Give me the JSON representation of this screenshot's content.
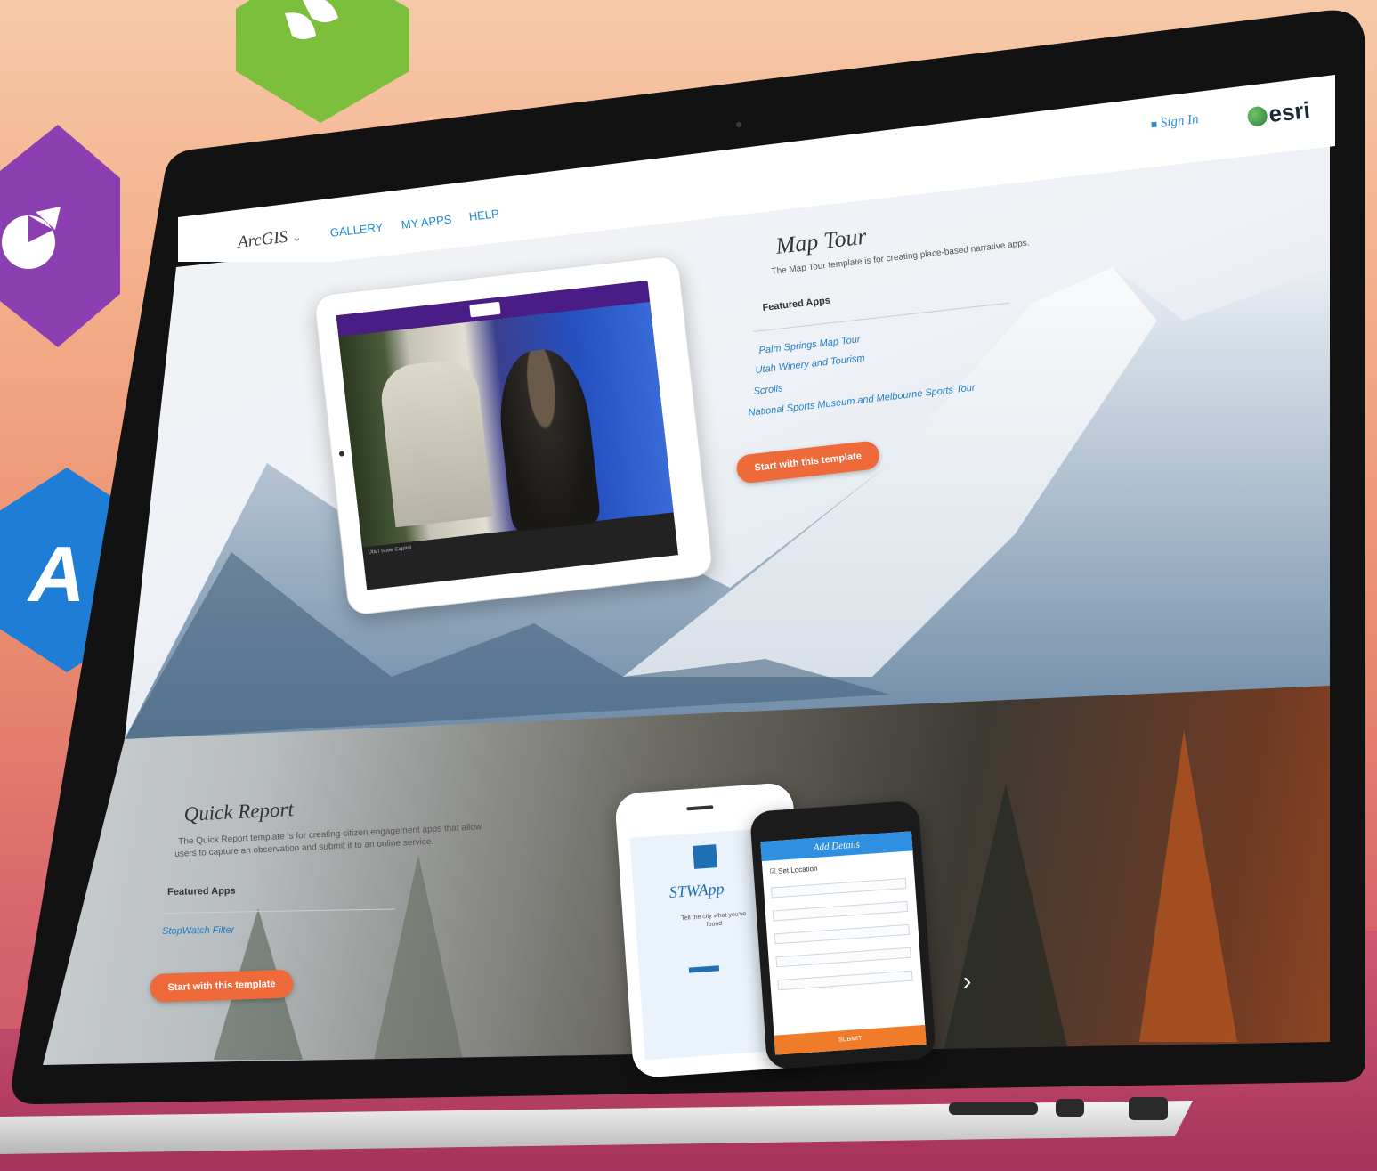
{
  "nav": {
    "brand": "ArcGIS",
    "brand_caret": "⌄",
    "items": [
      "GALLERY",
      "MY APPS",
      "HELP"
    ]
  },
  "account": {
    "sign_in": "Sign In",
    "logo_text": "esri"
  },
  "map_tour": {
    "title": "Map Tour",
    "description": "The Map Tour template is for creating place-based narrative apps.",
    "featured_label": "Featured Apps",
    "featured_apps": [
      "Palm Springs Map Tour",
      "Utah Winery and Tourism",
      "Scrolls",
      "National Sports Museum and Melbourne Sports Tour"
    ],
    "cta": "Start with this template"
  },
  "quick_report": {
    "title": "Quick Report",
    "description_line1": "The Quick Report template is for creating citizen engagement apps that allow",
    "description_line2": "users to capture an observation and submit it to an online service.",
    "featured_label": "Featured Apps",
    "featured_apps": [
      "StopWatch Filter"
    ],
    "cta": "Start with this template"
  },
  "tablet": {
    "caption": "Utah State Capitol"
  },
  "phone_white": {
    "app_name": "STWApp",
    "subtitle": "Tell the city what you've found"
  },
  "phone_dark": {
    "header": "Add Details",
    "checkbox": "Set Location",
    "submit": "SUBMIT"
  },
  "colors": {
    "accent": "#ef6a3b",
    "link": "#2080c8",
    "brand_green": "#2c7f3a"
  }
}
